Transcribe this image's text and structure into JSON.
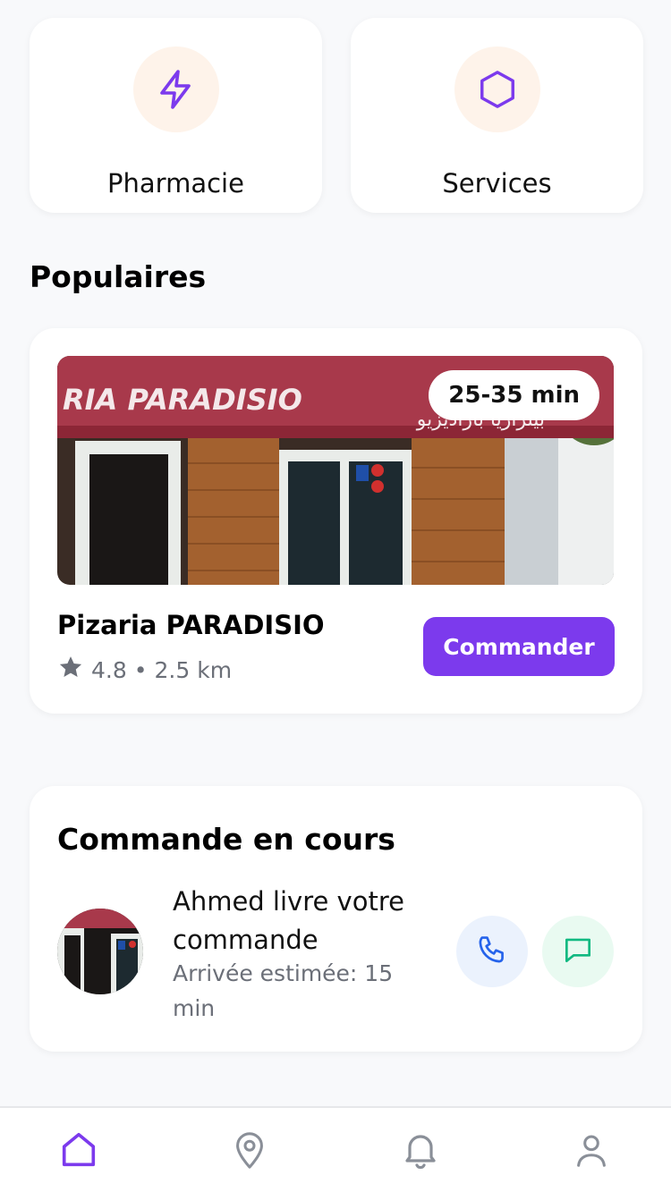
{
  "categories": [
    {
      "label": "Pharmacie",
      "icon": "lightning-icon"
    },
    {
      "label": "Services",
      "icon": "hexagon-icon"
    }
  ],
  "populaires": {
    "title": "Populaires",
    "restaurant": {
      "name": "Pizaria PARADISIO",
      "eta": "25-35 min",
      "rating": "4.8",
      "separator": "•",
      "distance": "2.5 km",
      "order_label": "Commander",
      "sign_text": "RIA PARADISIO",
      "sign_text_arabic": "بيتزاريا باراديزيو"
    }
  },
  "current_order": {
    "title": "Commande en cours",
    "message": "Ahmed livre votre commande",
    "eta": "Arrivée estimée: 15 min"
  },
  "nav": [
    "home-icon",
    "map-pin-icon",
    "bell-icon",
    "user-icon"
  ],
  "colors": {
    "accent": "#7c3aed",
    "call_blue": "#2563eb",
    "message_green": "#10b981",
    "nav_inactive": "#8a8f98"
  }
}
